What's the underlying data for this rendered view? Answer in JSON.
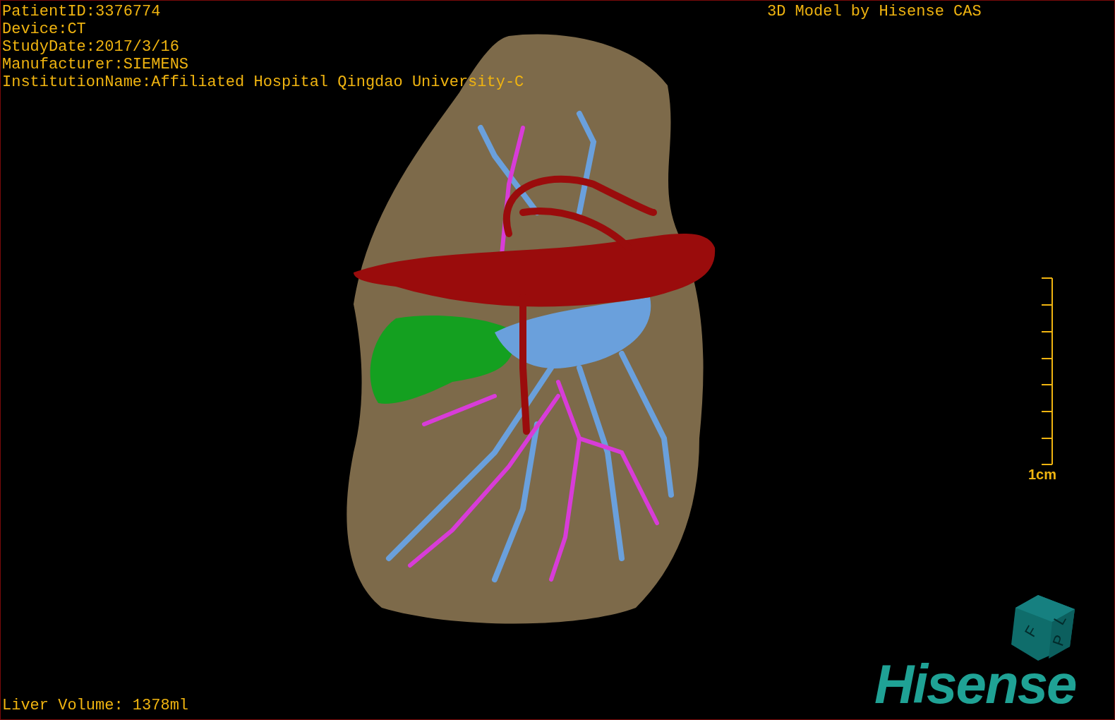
{
  "patient_info": [
    "PatientID:3376774",
    "Device:CT",
    "StudyDate:2017/3/16",
    "Manufacturer:SIEMENS",
    "InstitutionName:Affiliated Hospital Qingdao University-C"
  ],
  "title": "3D Model by Hisense CAS",
  "scale_bar": {
    "label": "1cm"
  },
  "orientation_cube": {
    "labels": [
      "F",
      "L",
      "P"
    ]
  },
  "liver_volume": "Liver Volume: 1378ml",
  "logo": "Hisense"
}
